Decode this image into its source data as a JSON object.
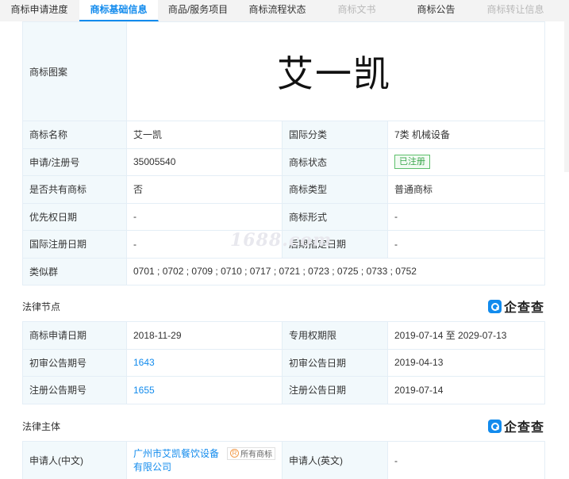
{
  "tabs": [
    {
      "label": "商标申请进度"
    },
    {
      "label": "商标基础信息"
    },
    {
      "label": "商品/服务项目"
    },
    {
      "label": "商标流程状态"
    },
    {
      "label": "商标文书"
    },
    {
      "label": "商标公告"
    },
    {
      "label": "商标转让信息"
    }
  ],
  "basic": {
    "logo_label": "商标图案",
    "logo_text": "艾一凯",
    "name_label": "商标名称",
    "name_value": "艾一凯",
    "intl_class_label": "国际分类",
    "intl_class_value": "7类 机械设备",
    "reg_no_label": "申请/注册号",
    "reg_no_value": "35005540",
    "status_label": "商标状态",
    "status_value": "已注册",
    "shared_label": "是否共有商标",
    "shared_value": "否",
    "type_label": "商标类型",
    "type_value": "普通商标",
    "priority_label": "优先权日期",
    "priority_value": "-",
    "form_label": "商标形式",
    "form_value": "-",
    "intl_reg_label": "国际注册日期",
    "intl_reg_value": "-",
    "late_label": "后期指定日期",
    "late_value": "-",
    "similar_label": "类似群",
    "similar_value": "0701 ; 0702 ; 0709 ; 0710 ; 0717 ; 0721 ; 0723 ; 0725 ; 0733 ; 0752"
  },
  "legal": {
    "title": "法律节点",
    "brand": "企查查",
    "apply_date_label": "商标申请日期",
    "apply_date_value": "2018-11-29",
    "exclusive_label": "专用权期限",
    "exclusive_value": "2019-07-14 至 2029-07-13",
    "prelim_no_label": "初审公告期号",
    "prelim_no_value": "1643",
    "prelim_date_label": "初审公告日期",
    "prelim_date_value": "2019-04-13",
    "reg_no_label": "注册公告期号",
    "reg_no_value": "1655",
    "reg_date_label": "注册公告日期",
    "reg_date_value": "2019-07-14"
  },
  "subject": {
    "title": "法律主体",
    "brand": "企查查",
    "applicant_cn_label": "申请人(中文)",
    "applicant_cn_value": "广州市艾凯餐饮设备有限公司",
    "owner_tag": "所有商标",
    "owner_tag_icon": "R",
    "applicant_en_label": "申请人(英文)",
    "applicant_en_value": "-"
  },
  "watermark": "1688.com",
  "colors": {
    "accent": "#128bed",
    "label_bg": "#f2f9fc",
    "border": "#e4eef6",
    "status_green": "#3aa64c"
  }
}
